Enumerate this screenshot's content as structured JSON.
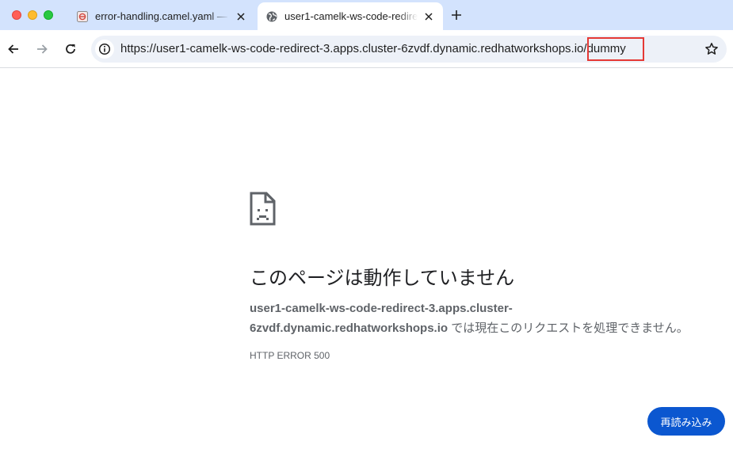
{
  "window": {
    "controls": [
      "close",
      "minimize",
      "maximize"
    ]
  },
  "tabs": [
    {
      "title": "error-handling.camel.yaml —",
      "favicon": "code-file-icon",
      "active": false
    },
    {
      "title": "user1-camelk-ws-code-redirect-3",
      "favicon": "globe-icon",
      "active": true
    }
  ],
  "toolbar": {
    "url": "https://user1-camelk-ws-code-redirect-3.apps.cluster-6zvdf.dynamic.redhatworkshops.io/dummy",
    "highlighted_segment": "/dummy"
  },
  "error_page": {
    "heading": "このページは動作していません",
    "host": "user1-camelk-ws-code-redirect-3.apps.cluster-6zvdf.dynamic.redhatworkshops.io",
    "message_suffix": " では現在このリクエストを処理できません。",
    "error_code": "HTTP ERROR 500",
    "reload_label": "再読み込み"
  },
  "colors": {
    "accent": "#0b57d0",
    "highlight": "#e53935",
    "titlebar": "#d3e3fd"
  }
}
